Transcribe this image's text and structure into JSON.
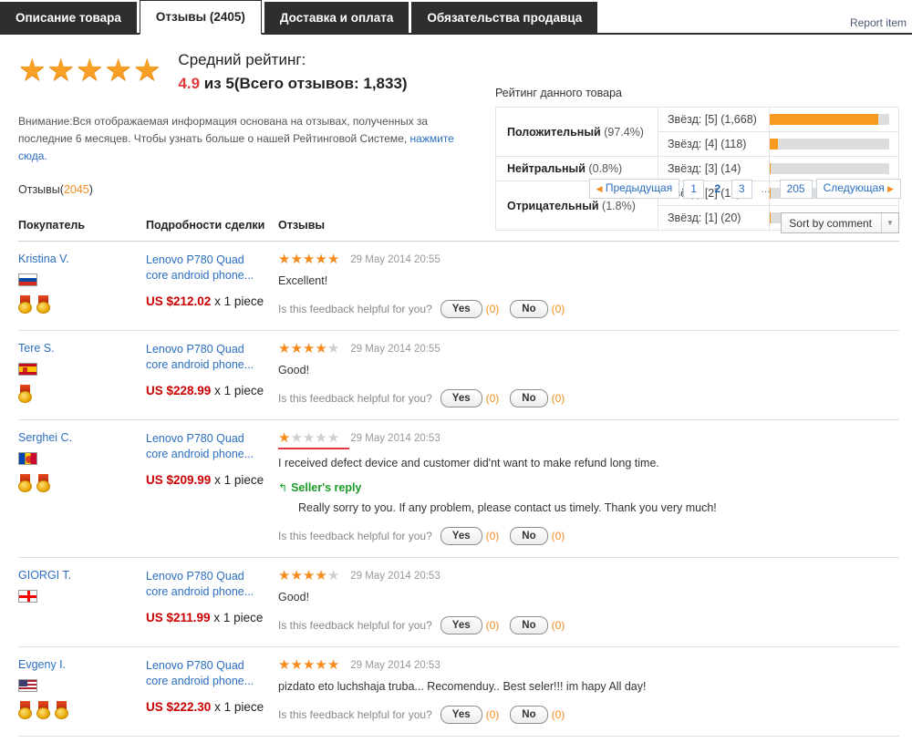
{
  "tabs": [
    {
      "label": "Описание товара",
      "active": false
    },
    {
      "label": "Отзывы (2405)",
      "active": true
    },
    {
      "label": "Доставка и оплата",
      "active": false
    },
    {
      "label": "Обязательства продавца",
      "active": false
    }
  ],
  "report_link": "Report item",
  "summary": {
    "stars_filled": 5,
    "avg_label": "Средний рейтинг:",
    "avg_value": "4.9",
    "avg_suffix": " из 5(Всего отзывов: 1,833)",
    "notice_text": "Внимание:Вся отображаемая информация основана на отзывах, полученных за последние 6 месяцев. Чтобы узнать больше о нашей Рейтинговой Системе, ",
    "notice_link": "нажмите сюда."
  },
  "rating_panel": {
    "title": "Рейтинг данного товара",
    "categories": [
      {
        "name": "Положительный",
        "percent": "(97.4%)",
        "rowspan": 2
      },
      {
        "name": "Нейтральный",
        "percent": "(0.8%)",
        "rowspan": 1
      },
      {
        "name": "Отрицательный",
        "percent": "(1.8%)",
        "rowspan": 2
      }
    ],
    "rows": [
      {
        "label": "Звёзд: [5] (1,668)",
        "bar_percent": 91
      },
      {
        "label": "Звёзд: [4] (118)",
        "bar_percent": 7
      },
      {
        "label": "Звёзд: [3] (14)",
        "bar_percent": 1
      },
      {
        "label": "Звёзд: [2] (13)",
        "bar_percent": 1
      },
      {
        "label": "Звёзд: [1] (20)",
        "bar_percent": 1
      }
    ]
  },
  "reviews_header": {
    "count_label": "Отзывы(",
    "count_value": "2045",
    "count_suffix": ")"
  },
  "pagination": {
    "prev_label": "Предыдущая",
    "next_label": "Следующая",
    "pages": [
      "1",
      "2",
      "3"
    ],
    "dots": "...",
    "last_page": "205",
    "current": "2"
  },
  "table_headers": {
    "buyer": "Покупатель",
    "deal": "Подробности сделки",
    "review": "Отзывы"
  },
  "sort": {
    "selected": "Sort by comment"
  },
  "helpful_prompt": "Is this feedback helpful for you?",
  "vote_yes": "Yes",
  "vote_no": "No",
  "vote_zero": "(0)",
  "seller_reply_label": "Seller's reply",
  "colors": {
    "star_on": "#f68b1e",
    "star_off": "#cfcfcf",
    "price": "#cc0000",
    "link": "#2b6ec0",
    "accent_orange": "#f68b1e",
    "tab_dark": "#2e2e2e",
    "reply_green": "#1a9b28"
  },
  "reviews": [
    {
      "buyer": "Kristina V.",
      "flag": "ru",
      "medals": 2,
      "product": "Lenovo P780 Quad core android phone...",
      "price": "US $212.02",
      "qty": " x 1 piece",
      "stars": 5,
      "underline": false,
      "date": "29 May 2014 20:55",
      "text": "Excellent!",
      "reply": null,
      "yes_count": "(0)",
      "no_count": "(0)"
    },
    {
      "buyer": "Tere S.",
      "flag": "es",
      "medals": 1,
      "product": "Lenovo P780 Quad core android phone...",
      "price": "US $228.99",
      "qty": " x 1 piece",
      "stars": 4,
      "underline": false,
      "date": "29 May 2014 20:55",
      "text": "Good!",
      "reply": null,
      "yes_count": "(0)",
      "no_count": "(0)"
    },
    {
      "buyer": "Serghei C.",
      "flag": "md",
      "medals": 2,
      "product": "Lenovo P780 Quad core android phone...",
      "price": "US $209.99",
      "qty": " x 1 piece",
      "stars": 1,
      "underline": true,
      "date": "29 May 2014 20:53",
      "text": "I received defect device and customer did'nt want to make refund long time.",
      "reply": "Really sorry to you. If any problem, please contact us timely. Thank you very much!",
      "yes_count": "(0)",
      "no_count": "(0)"
    },
    {
      "buyer": "GIORGI T.",
      "flag": "ge",
      "medals": 0,
      "product": "Lenovo P780 Quad core android phone...",
      "price": "US $211.99",
      "qty": " x 1 piece",
      "stars": 4,
      "underline": false,
      "date": "29 May 2014 20:53",
      "text": "Good!",
      "reply": null,
      "yes_count": "(0)",
      "no_count": "(0)"
    },
    {
      "buyer": "Evgeny I.",
      "flag": "us",
      "medals": 3,
      "product": "Lenovo P780 Quad core android phone...",
      "price": "US $222.30",
      "qty": " x 1 piece",
      "stars": 5,
      "underline": false,
      "date": "29 May 2014 20:53",
      "text": "pizdato eto luchshaja truba... Recomenduy.. Best seler!!! im hapy All day!",
      "reply": null,
      "yes_count": "(0)",
      "no_count": "(0)"
    }
  ]
}
